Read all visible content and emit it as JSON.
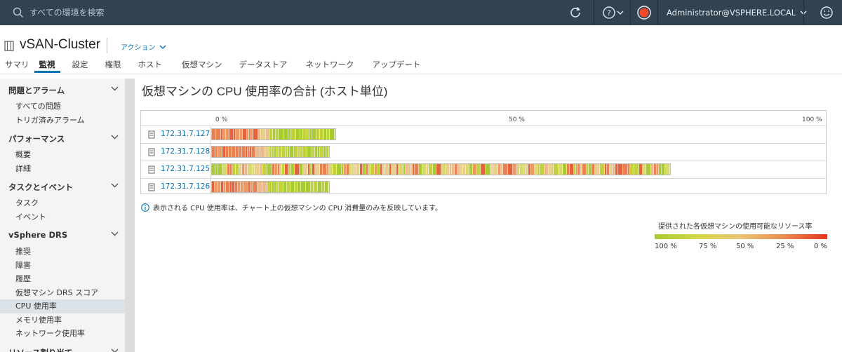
{
  "topbar": {
    "search_placeholder": "すべての環境を検索",
    "user": "Administrator@VSPHERE.LOCAL"
  },
  "header": {
    "title": "vSAN-Cluster",
    "actions_label": "アクション"
  },
  "tabs": [
    "サマリ",
    "監視",
    "設定",
    "権限",
    "ホスト",
    "仮想マシン",
    "データストア",
    "ネットワーク",
    "アップデート"
  ],
  "active_tab": "監視",
  "sidebar": {
    "groups": [
      {
        "label": "問題とアラーム",
        "items": [
          "すべての問題",
          "トリガ済みアラーム"
        ]
      },
      {
        "label": "パフォーマンス",
        "items": [
          "概要",
          "詳細"
        ]
      },
      {
        "label": "タスクとイベント",
        "items": [
          "タスク",
          "イベント"
        ]
      },
      {
        "label": "vSphere DRS",
        "items": [
          "推奨",
          "障害",
          "履歴",
          "仮想マシン DRS スコア",
          "CPU 使用率",
          "メモリ使用率",
          "ネットワーク使用率"
        ]
      },
      {
        "label": "リソース割り当て",
        "items": []
      }
    ],
    "selected_item": "CPU 使用率"
  },
  "main": {
    "title": "仮想マシンの CPU 使用率の合計 (ホスト単位)",
    "note": "表示される CPU 使用率は、チャート上の仮想マシンの CPU 消費量のみを反映しています。",
    "legend_title": "提供された各仮想マシンの使用可能なリソース率",
    "legend_labels": [
      "100 %",
      "75 %",
      "50 %",
      "25 %",
      "0 %"
    ]
  },
  "chart_data": {
    "type": "bar",
    "orientation": "horizontal",
    "x_ticks": [
      "0 %",
      "50 %",
      "100 %"
    ],
    "xlim": [
      0,
      100
    ],
    "hosts": [
      {
        "name": "172.31.7.127",
        "total_percent": 20.5
      },
      {
        "name": "172.31.7.128",
        "total_percent": 19.5
      },
      {
        "name": "172.31.7.125",
        "total_percent": 75.5
      },
      {
        "name": "172.31.7.126",
        "total_percent": 19.5
      }
    ],
    "colors": {
      "high": "#a8cc2f",
      "mid": "#eac574",
      "low": "#e8341c"
    }
  }
}
